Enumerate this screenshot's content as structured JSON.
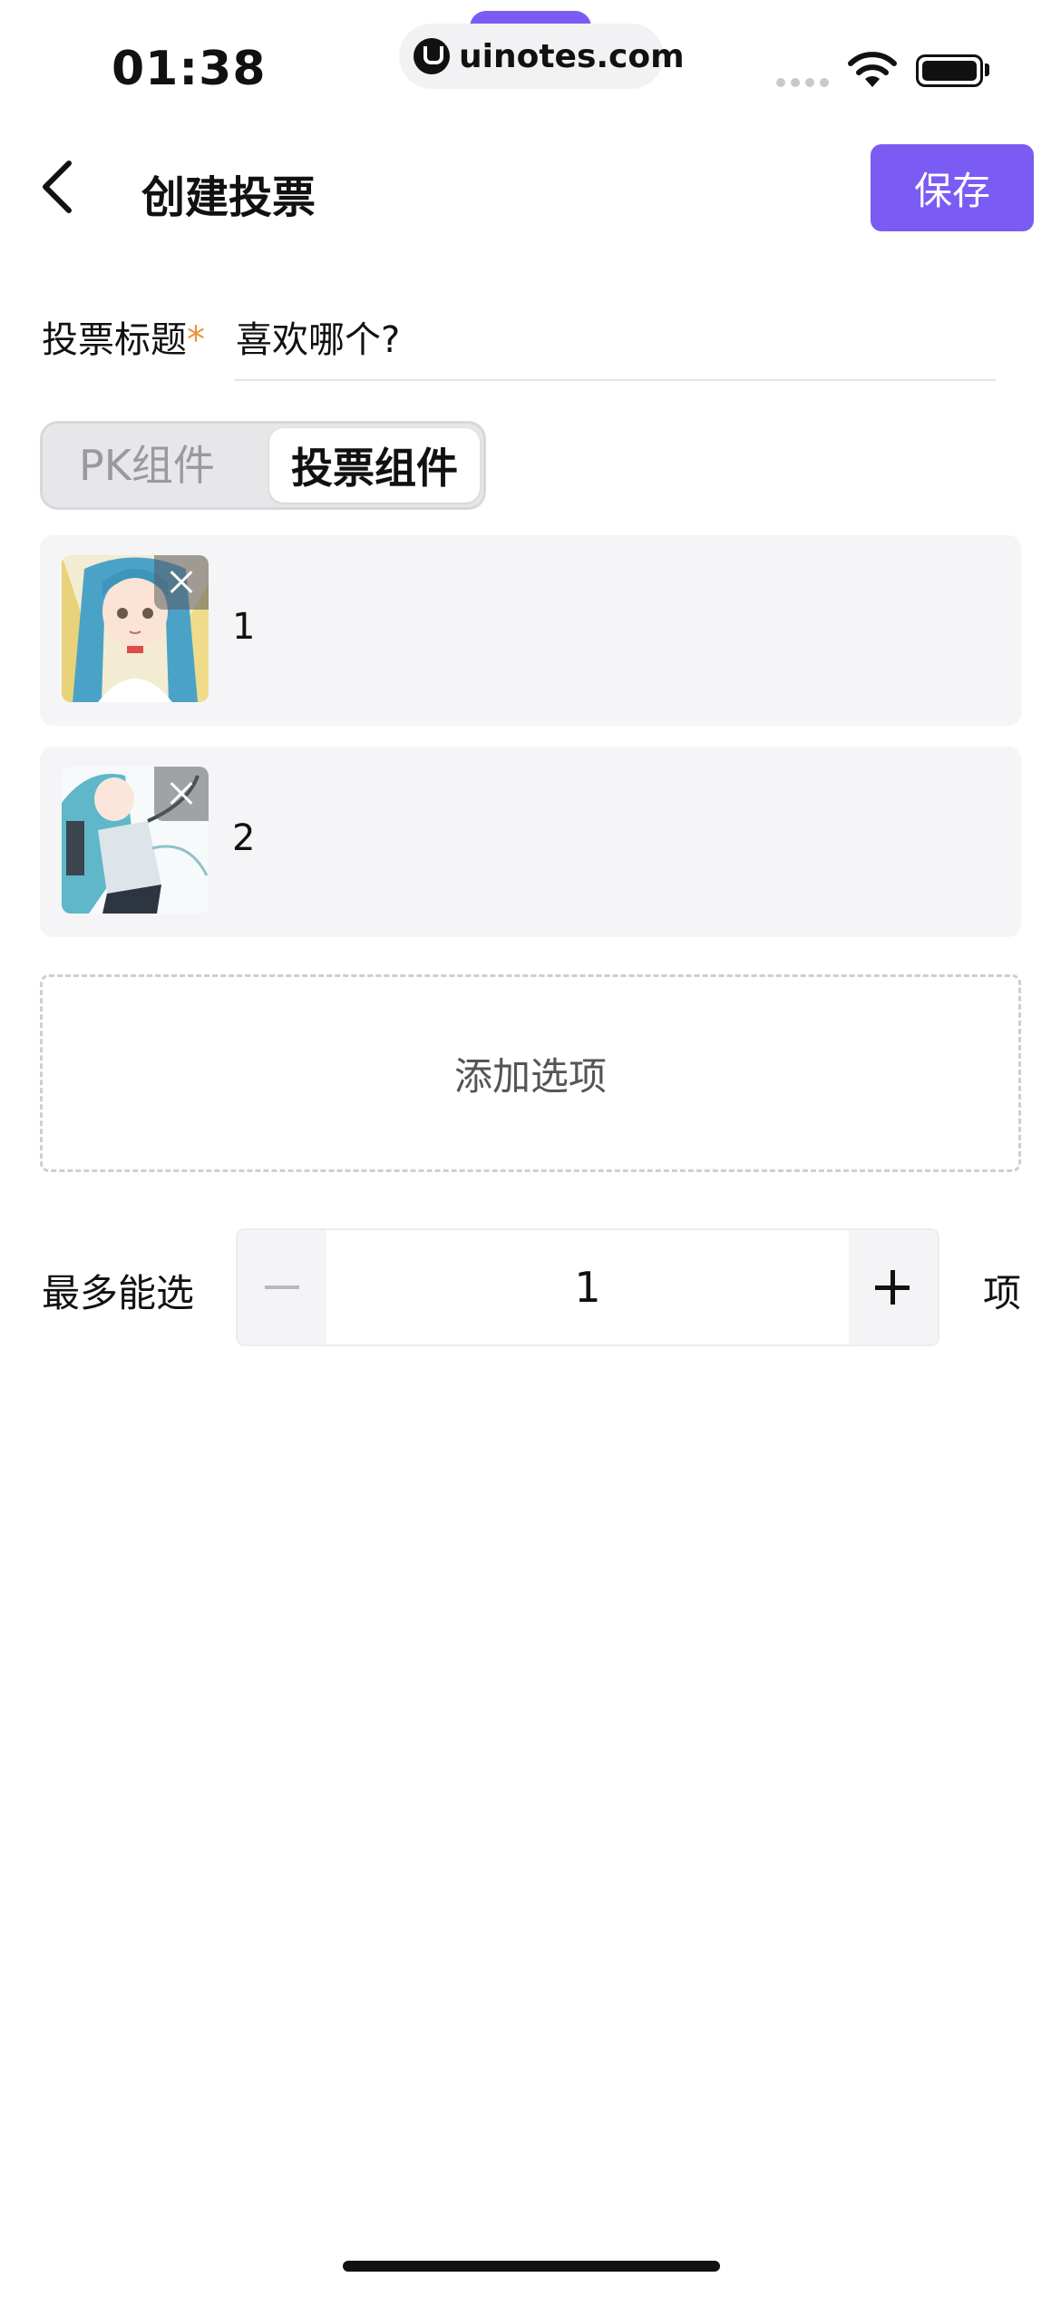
{
  "status_bar": {
    "time": "01:38",
    "url": "uinotes.com",
    "icons": [
      "signal-icon",
      "wifi-icon",
      "battery-icon"
    ]
  },
  "header": {
    "back_icon": "chevron-left-icon",
    "title": "创建投票",
    "save_label": "保存",
    "accent_color": "#7a5cf5"
  },
  "vote_title": {
    "label": "投票标题",
    "required_mark": "*",
    "value": "喜欢哪个?"
  },
  "segmented": {
    "tabs": [
      {
        "label": "PK组件",
        "selected": false
      },
      {
        "label": "投票组件",
        "selected": true
      }
    ]
  },
  "options": [
    {
      "text": "1",
      "image": "anime-character-thumbnail",
      "remove_icon": "close-icon"
    },
    {
      "text": "2",
      "image": "anime-character-thumbnail",
      "remove_icon": "close-icon"
    }
  ],
  "add_option_label": "添加选项",
  "max_select": {
    "label": "最多能选",
    "value": "1",
    "unit": "项",
    "minus_icon": "minus-icon",
    "plus_icon": "plus-icon"
  }
}
